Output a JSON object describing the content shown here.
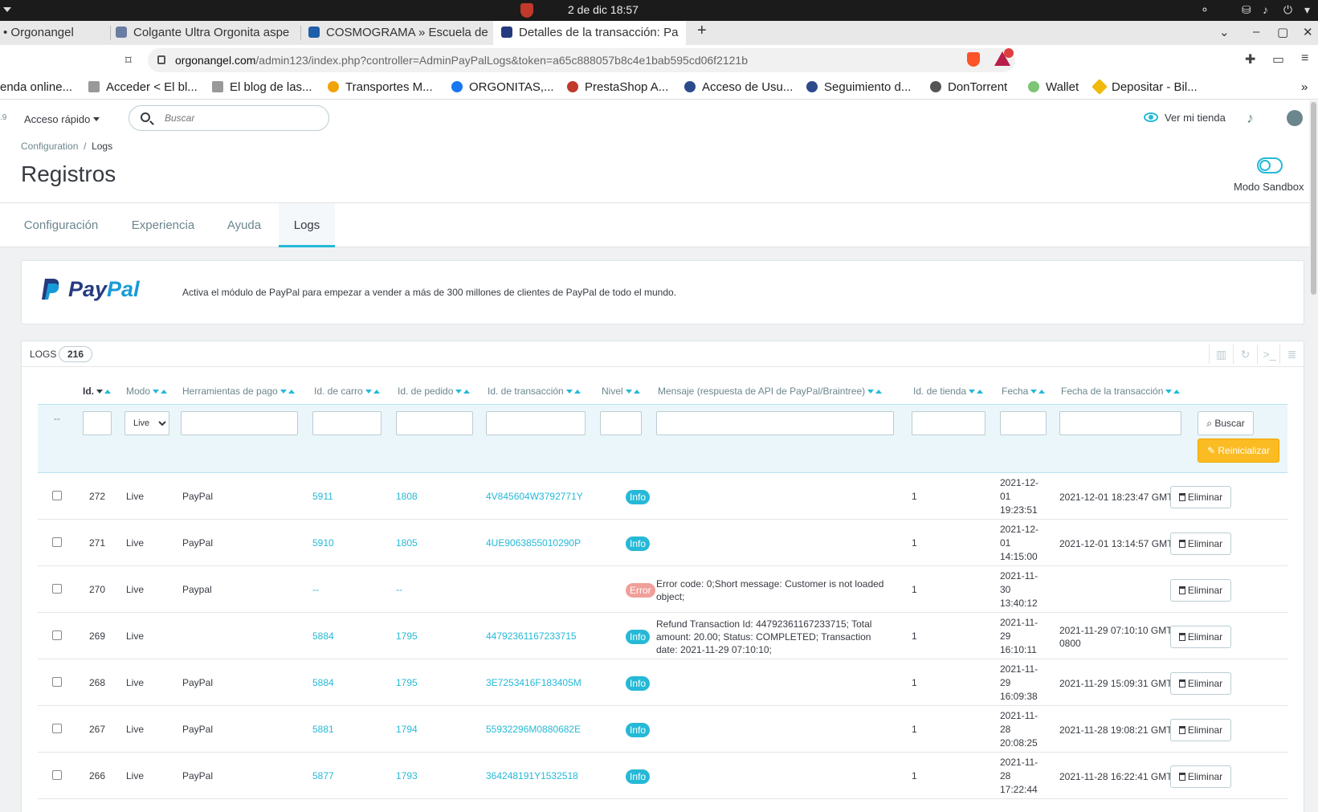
{
  "os": {
    "datetime": "2 de dic  18:57"
  },
  "browser": {
    "tabs": [
      {
        "label": "• Orgonangel"
      },
      {
        "label": "Colgante Ultra Orgonita aspe"
      },
      {
        "label": "COSMOGRAMA » Escuela de A"
      },
      {
        "label": "Detalles de la transacción: Pa"
      }
    ],
    "new_tab": "+",
    "url_domain": "orgonangel.com",
    "url_path": "/admin123/index.php?controller=AdminPayPalLogs&token=a65c888057b8c4e1bab595cd06f2121b",
    "bookmarks": [
      {
        "label": "enda online..."
      },
      {
        "label": "Acceder < El bl..."
      },
      {
        "label": "El blog de las..."
      },
      {
        "label": "Transportes M..."
      },
      {
        "label": "ORGONITAS,..."
      },
      {
        "label": "PrestaShop A..."
      },
      {
        "label": "Acceso de Usu..."
      },
      {
        "label": "Seguimiento d..."
      },
      {
        "label": "DonTorrent"
      },
      {
        "label": "Wallet"
      },
      {
        "label": "Depositar - Bil..."
      }
    ],
    "more": "»"
  },
  "header": {
    "version": ".9",
    "quick_access": "Acceso rápido",
    "search_placeholder": "Buscar",
    "view_shop": "Ver mi tienda"
  },
  "page": {
    "breadcrumb_parent": "Configuration",
    "breadcrumb_sep": "/",
    "breadcrumb_current": "Logs",
    "title": "Registros",
    "sandbox_label": "Modo Sandbox"
  },
  "tabs": [
    {
      "label": "Configuración"
    },
    {
      "label": "Experiencia"
    },
    {
      "label": "Ayuda"
    },
    {
      "label": "Logs"
    }
  ],
  "banner": {
    "logo_pay": "Pay",
    "logo_pal": "Pal",
    "text": "Activa el módulo de PayPal para empezar a vender a más de 300 millones de clientes de PayPal de todo el mundo."
  },
  "logs": {
    "title": "LOGS",
    "count": "216",
    "columns": {
      "id": "Id.",
      "mode": "Modo",
      "tool": "Herramientas de pago",
      "cart": "Id. de carro",
      "order": "Id. de pedido",
      "transaction": "Id. de transacción",
      "level": "Nivel",
      "message": "Mensaje (respuesta de API de PayPal/Braintree)",
      "shop": "Id. de tienda",
      "date": "Fecha",
      "tx_date": "Fecha de la transacción"
    },
    "filter": {
      "dash": "--",
      "mode_value": "Live",
      "search_btn": "Buscar",
      "reset_btn": "Reinicializar"
    },
    "delete_label": "Eliminar",
    "rows": [
      {
        "id": "272",
        "mode": "Live",
        "tool": "PayPal",
        "cart": "5911",
        "order": "1808",
        "tx": "4V845604W3792771Y",
        "level": "Info",
        "level_type": "info",
        "msg": "",
        "shop": "1",
        "date": "2021-12-\n01\n19:23:51",
        "txdate": "2021-12-01 18:23:47 GMT"
      },
      {
        "id": "271",
        "mode": "Live",
        "tool": "PayPal",
        "cart": "5910",
        "order": "1805",
        "tx": "4UE9063855010290P",
        "level": "Info",
        "level_type": "info",
        "msg": "",
        "shop": "1",
        "date": "2021-12-\n01\n14:15:00",
        "txdate": "2021-12-01 13:14:57 GMT"
      },
      {
        "id": "270",
        "mode": "Live",
        "tool": "Paypal",
        "cart": "--",
        "order": "--",
        "tx": "",
        "level": "Error",
        "level_type": "error",
        "msg": "Error code: 0;Short message: Customer is not loaded object;",
        "shop": "1",
        "date": "2021-11-\n30\n13:40:12",
        "txdate": ""
      },
      {
        "id": "269",
        "mode": "Live",
        "tool": "",
        "cart": "5884",
        "order": "1795",
        "tx": "44792361167233715",
        "level": "Info",
        "level_type": "info",
        "msg": "Refund Transaction Id: 44792361167233715; Total amount: 20.00; Status: COMPLETED; Transaction date: 2021-11-29 07:10:10;",
        "shop": "1",
        "date": "2021-11-\n29\n16:10:11",
        "txdate": "2021-11-29 07:10:10 GMT-0800"
      },
      {
        "id": "268",
        "mode": "Live",
        "tool": "PayPal",
        "cart": "5884",
        "order": "1795",
        "tx": "3E7253416F183405M",
        "level": "Info",
        "level_type": "info",
        "msg": "",
        "shop": "1",
        "date": "2021-11-\n29\n16:09:38",
        "txdate": "2021-11-29 15:09:31 GMT"
      },
      {
        "id": "267",
        "mode": "Live",
        "tool": "PayPal",
        "cart": "5881",
        "order": "1794",
        "tx": "55932296M0880682E",
        "level": "Info",
        "level_type": "info",
        "msg": "",
        "shop": "1",
        "date": "2021-11-\n28\n20:08:25",
        "txdate": "2021-11-28 19:08:21 GMT"
      },
      {
        "id": "266",
        "mode": "Live",
        "tool": "PayPal",
        "cart": "5877",
        "order": "1793",
        "tx": "364248191Y1532518",
        "level": "Info",
        "level_type": "info",
        "msg": "",
        "shop": "1",
        "date": "2021-11-\n28\n17:22:44",
        "txdate": "2021-11-28 16:22:41 GMT"
      }
    ]
  }
}
